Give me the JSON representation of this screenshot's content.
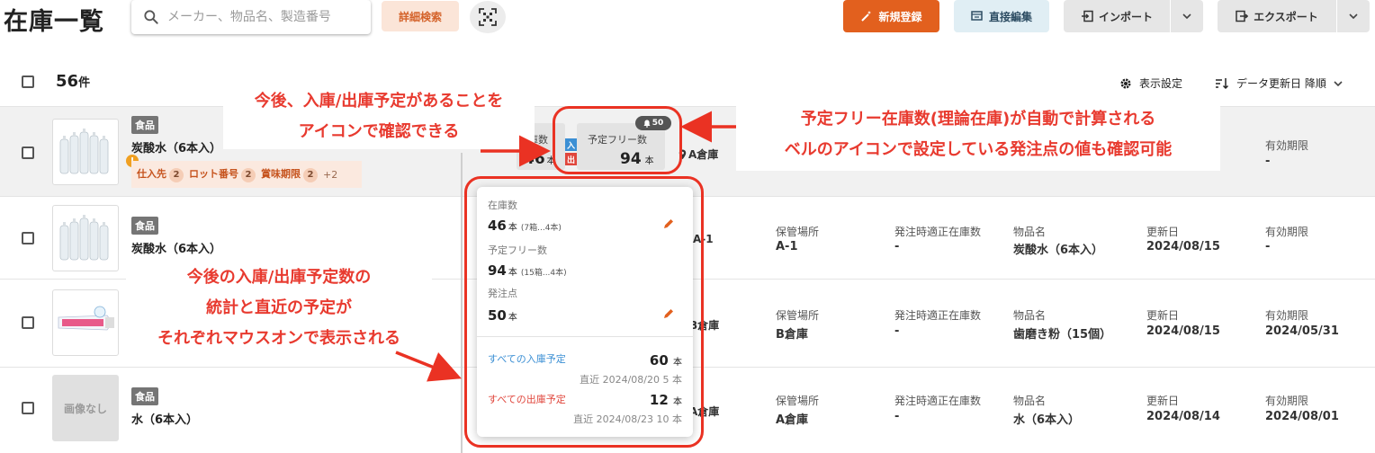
{
  "header": {
    "title": "在庫一覧",
    "search_placeholder": "メーカー、物品名、製造番号",
    "advanced_search": "詳細検索",
    "new_button": "新規登録",
    "direct_edit_button": "直接編集",
    "import_button": "インポート",
    "export_button": "エクスポート"
  },
  "toolbar": {
    "count_number": "56",
    "count_unit": "件",
    "display_settings": "表示設定",
    "sort_label": "データ更新日 降順"
  },
  "rows": [
    {
      "category": "食品",
      "name": "炭酸水（6本入）",
      "tags": [
        {
          "label": "仕入先",
          "count": "2"
        },
        {
          "label": "ロット番号",
          "count": "2"
        },
        {
          "label": "賞味期限",
          "count": "2"
        }
      ],
      "tags_more": "+2",
      "stock_label": "在庫数",
      "stock_value": "46",
      "stock_unit": "本",
      "free_label": "予定フリー数",
      "free_value": "94",
      "free_unit": "本",
      "bell_value": "50",
      "in_badge": "入",
      "out_badge": "出",
      "location": "A倉庫",
      "expiry_label": "有効期限",
      "expiry_value": "-"
    },
    {
      "category": "食品",
      "name": "炭酸水（6本入）",
      "location_partial": "A-1",
      "storage_label": "保管場所",
      "storage_value": "A-1",
      "reorder_label": "発注時適正在庫数",
      "reorder_value": "-",
      "item_label": "物品名",
      "item_value": "炭酸水（6本入）",
      "updated_label": "更新日",
      "updated_value": "2024/08/15",
      "expiry_label": "有効期限",
      "expiry_value": "-"
    },
    {
      "location_partial": "B倉庫",
      "storage_label": "保管場所",
      "storage_value": "B倉庫",
      "reorder_label": "発注時適正在庫数",
      "reorder_value": "-",
      "item_label": "物品名",
      "item_value": "歯磨き粉（15個）",
      "updated_label": "更新日",
      "updated_value": "2024/08/15",
      "expiry_label": "有効期限",
      "expiry_value": "2024/05/31"
    },
    {
      "no_image": "画像なし",
      "category": "食品",
      "name": "水（6本入）",
      "location_partial": "A倉庫",
      "storage_label": "保管場所",
      "storage_value": "A倉庫",
      "reorder_label": "発注時適正在庫数",
      "reorder_value": "-",
      "item_label": "物品名",
      "item_value": "水（6本入）",
      "updated_label": "更新日",
      "updated_value": "2024/08/14",
      "expiry_label": "有効期限",
      "expiry_value": "2024/08/01"
    }
  ],
  "popup": {
    "stock_label": "在庫数",
    "stock_value": "46",
    "stock_unit": "本",
    "stock_sub": "(7箱...4本)",
    "free_label": "予定フリー数",
    "free_value": "94",
    "free_unit": "本",
    "free_sub": "(15箱...4本)",
    "reorder_label": "発注点",
    "reorder_value": "50",
    "reorder_unit": "本",
    "in_link": "すべての入庫予定",
    "in_total": "60",
    "in_unit": "本",
    "in_recent": "直近 2024/08/20 5 本",
    "out_link": "すべての出庫予定",
    "out_total": "12",
    "out_unit": "本",
    "out_recent": "直近 2024/08/23 10 本"
  },
  "annotations": {
    "note1_line1": "今後、入庫/出庫予定があることを",
    "note1_line2": "アイコンで確認できる",
    "note2_line1": "予定フリー在庫数(理論在庫)が自動で計算される",
    "note2_line2": "ベルのアイコンで設定している発注点の値も確認可能",
    "note3_line1": "今後の入庫/出庫予定数の",
    "note3_line2": "統計と直近の予定が",
    "note3_line3": "それぞれマウスオンで表示される"
  },
  "colors": {
    "accent_orange": "#e2601e",
    "annotation_red": "#ea3223",
    "in_blue": "#3b8fd4",
    "out_red": "#e0463c"
  }
}
